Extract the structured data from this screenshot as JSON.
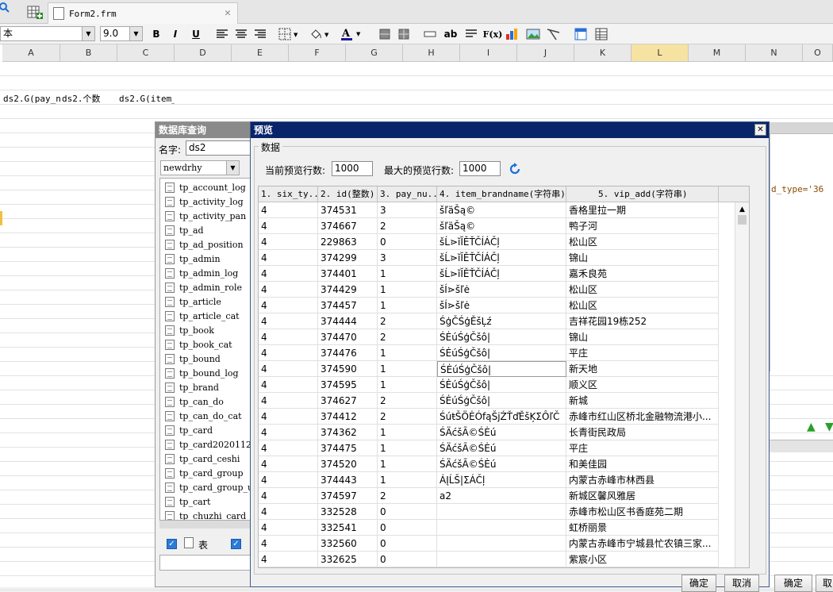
{
  "tabs": {
    "file": "Form2.frm"
  },
  "toolbar": {
    "font_name": "本",
    "font_size": "9.0",
    "bold": "B",
    "italic": "I",
    "underline": "U",
    "ab": "ab",
    "fx": "F(x)"
  },
  "sheet": {
    "columns": [
      "A",
      "B",
      "C",
      "D",
      "E",
      "F",
      "G",
      "H",
      "I",
      "J",
      "K",
      "L",
      "M",
      "N",
      "O"
    ],
    "cells": [
      "ds2.G(pay_n",
      "ds2.个数",
      "ds2.G(item_"
    ],
    "sql_snippet": "d_type='36"
  },
  "db_dialog": {
    "title": "数据库查询",
    "name_label": "名字:",
    "name_value": "ds2",
    "connection": "newdrhy",
    "tables": [
      "tp_account_log",
      "tp_activity_log",
      "tp_activity_pan",
      "tp_ad",
      "tp_ad_position",
      "tp_admin",
      "tp_admin_log",
      "tp_admin_role",
      "tp_article",
      "tp_article_cat",
      "tp_book",
      "tp_book_cat",
      "tp_bound",
      "tp_bound_log",
      "tp_brand",
      "tp_can_do",
      "tp_can_do_cat",
      "tp_card",
      "tp_card20201120",
      "tp_card_ceshi",
      "tp_card_group",
      "tp_card_group_u",
      "tp_cart",
      "tp_chuzhi_card"
    ],
    "check_table_label": "表"
  },
  "preview": {
    "title": "预览",
    "group_label": "数据",
    "current_rows_label": "当前预览行数:",
    "current_rows_value": "1000",
    "max_rows_label": "最大的预览行数:",
    "max_rows_value": "1000",
    "columns": [
      "1. six_ty...",
      "2. id(整数)",
      "3. pay_nu...",
      "4. item_brandname(字符串)",
      "5. vip_add(字符串)"
    ],
    "rows": [
      [
        "4",
        "374531",
        "3",
        "šľäŠą©",
        "香格里拉一期"
      ],
      [
        "4",
        "374667",
        "2",
        "šľäŠą©",
        "鸭子河"
      ],
      [
        "4",
        "229863",
        "0",
        "šĹ⋗ĭĬĚŤČÍÁČļ",
        "松山区"
      ],
      [
        "4",
        "374299",
        "3",
        "šĹ⋗ĭĬĚŤČÍÁČļ",
        "锦山"
      ],
      [
        "4",
        "374401",
        "1",
        "šĹ⋗ĭĬĚŤČÍÁČļ",
        "嘉禾良苑"
      ],
      [
        "4",
        "374429",
        "1",
        "šÍ⋗šľė",
        "松山区"
      ],
      [
        "4",
        "374457",
        "1",
        "šÍ⋗šľė",
        "松山区"
      ],
      [
        "4",
        "374444",
        "2",
        "ŚģČŚģĚšĻź",
        "吉祥花园19栋252"
      ],
      [
        "4",
        "374470",
        "2",
        "ŚĖúŚģČšô|",
        "锦山"
      ],
      [
        "4",
        "374476",
        "1",
        "ŚĖúŚģČšô|",
        "平庄"
      ],
      [
        "4",
        "374590",
        "1",
        "ŚĖúŚģČšô|",
        "新天地"
      ],
      [
        "4",
        "374595",
        "1",
        "ŚĖúŚģČšô|",
        "顺义区"
      ],
      [
        "4",
        "374627",
        "2",
        "ŚĖúŚģČšô|",
        "新城"
      ],
      [
        "4",
        "374412",
        "2",
        "ŚúŧŠÖĖÓfąŠjŹŤďĚšĶΣÔľČ",
        "赤峰市红山区桥北金融物流港小..."
      ],
      [
        "4",
        "374362",
        "1",
        "ŚÄćšÃ©ŚĖú",
        "长青街民政局"
      ],
      [
        "4",
        "374475",
        "1",
        "ŚÄćšÃ©ŚĖú",
        "平庄"
      ],
      [
        "4",
        "374520",
        "1",
        "ŚÄćšÃ©ŚĖú",
        "和美佳园"
      ],
      [
        "4",
        "374443",
        "1",
        "ÁĮĹŠ|ΣÁČļ",
        "内蒙古赤峰市林西县"
      ],
      [
        "4",
        "374597",
        "2",
        "a2",
        "新城区馨风雅居"
      ],
      [
        "4",
        "332528",
        "0",
        "",
        "赤峰市松山区书香庭苑二期"
      ],
      [
        "4",
        "332541",
        "0",
        "",
        "虹桥丽景"
      ],
      [
        "4",
        "332560",
        "0",
        "",
        "内蒙古赤峰市宁城县忙农镇三家..."
      ],
      [
        "4",
        "332625",
        "0",
        "",
        "紫宸小区"
      ]
    ],
    "ok_label": "确定",
    "cancel_label": "取消"
  },
  "background_buttons": {
    "ok": "确定",
    "cancel": "取"
  }
}
